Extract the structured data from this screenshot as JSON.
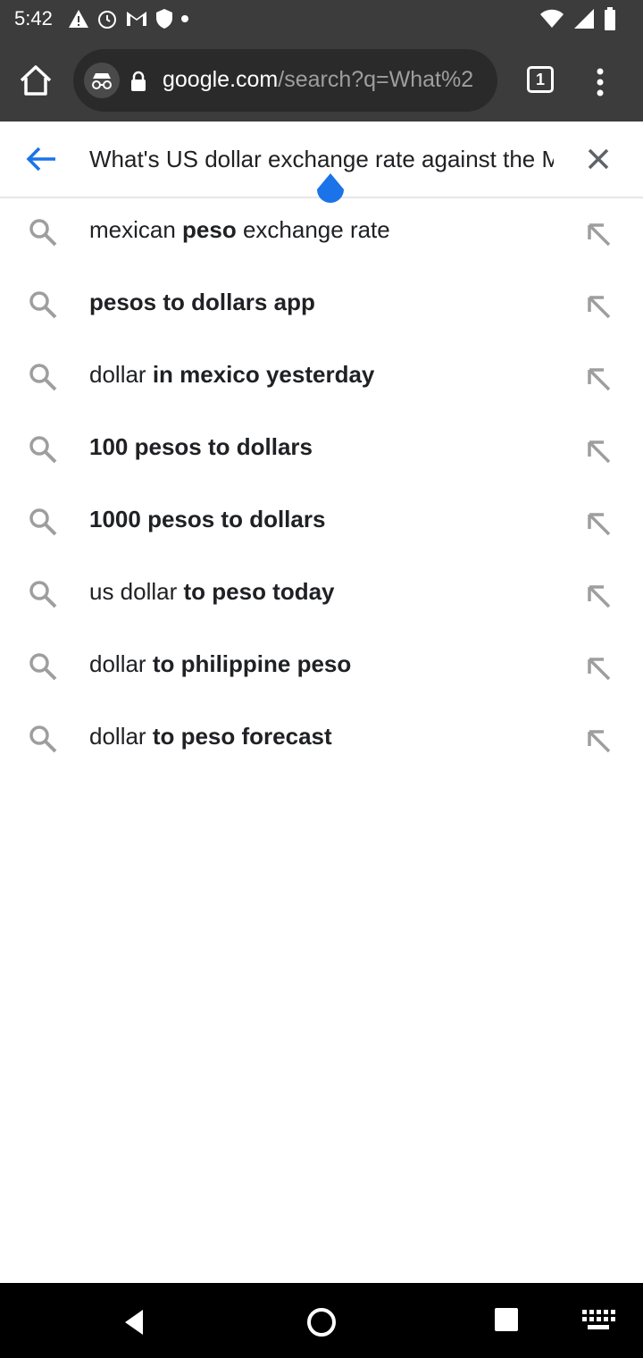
{
  "status_bar": {
    "time": "5:42",
    "left_icons": [
      "warning-icon",
      "alarm-icon",
      "gmail-icon",
      "shield-icon",
      "dot-icon"
    ],
    "right_icons": [
      "wifi-icon",
      "signal-icon",
      "battery-icon"
    ]
  },
  "toolbar": {
    "url_domain": "google.com",
    "url_path": "/search?q=What%2",
    "tab_count": "1"
  },
  "search": {
    "query": "What's US dollar exchange rate against the Mexican peso"
  },
  "suggestions": [
    {
      "normal_1": "mexican ",
      "bold_1": "peso",
      "normal_2": " exchange rate",
      "bold_2": ""
    },
    {
      "normal_1": "",
      "bold_1": "pesos to dollars app",
      "normal_2": "",
      "bold_2": ""
    },
    {
      "normal_1": "dollar",
      "bold_1": " in mexico yesterday",
      "normal_2": "",
      "bold_2": ""
    },
    {
      "normal_1": "",
      "bold_1": "100 pesos to dollars",
      "normal_2": "",
      "bold_2": ""
    },
    {
      "normal_1": "",
      "bold_1": "1000 pesos to dollars",
      "normal_2": "",
      "bold_2": ""
    },
    {
      "normal_1": "us dollar",
      "bold_1": " to peso today",
      "normal_2": "",
      "bold_2": ""
    },
    {
      "normal_1": "dollar",
      "bold_1": " to philippine peso",
      "normal_2": "",
      "bold_2": ""
    },
    {
      "normal_1": "dollar",
      "bold_1": " to peso forecast",
      "normal_2": "",
      "bold_2": ""
    }
  ],
  "colors": {
    "toolbar_bg": "#3c3c3c",
    "url_box_bg": "#2a2a2a",
    "accent_blue": "#1a73e8",
    "icon_gray": "#757575",
    "text_dark": "#202124"
  }
}
